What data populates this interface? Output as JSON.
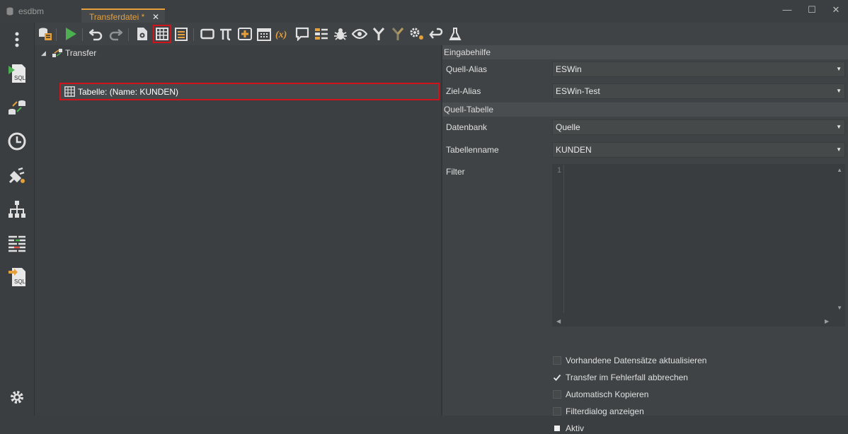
{
  "titlebar": {
    "app_name": "esdbm",
    "tab_label": "Transferdatei *",
    "tab_close": "✕",
    "minimize": "—",
    "maximize": "☐",
    "close": "✕"
  },
  "toolbar": {
    "icons": [
      "database-list-icon",
      "run-icon",
      "undo-icon",
      "redo-icon",
      "file-settings-icon",
      "table-icon",
      "notes-icon",
      "rectangle-icon",
      "pi-icon",
      "add-box-icon",
      "calendar-icon",
      "variable-icon",
      "comment-icon",
      "list-settings-icon",
      "bug-icon",
      "eye-icon",
      "merge-icon",
      "branch-icon",
      "gear-cluster-icon",
      "return-icon",
      "flask-icon"
    ]
  },
  "tree": {
    "root_label": "Transfer",
    "child_label": "Tabelle: (Name: KUNDEN)"
  },
  "props": {
    "section1": "Eingabehilfe",
    "quell_alias_label": "Quell-Alias",
    "quell_alias_value": "ESWin",
    "ziel_alias_label": "Ziel-Alias",
    "ziel_alias_value": "ESWin-Test",
    "section2": "Quell-Tabelle",
    "datenbank_label": "Datenbank",
    "datenbank_value": "Quelle",
    "tabellenname_label": "Tabellenname",
    "tabellenname_value": "KUNDEN",
    "filter_label": "Filter",
    "filter_line": "1",
    "checkboxes": [
      {
        "label": "Vorhandene Datensätze aktualisieren",
        "checked": false
      },
      {
        "label": "Transfer im Fehlerfall abbrechen",
        "checked": true
      },
      {
        "label": "Automatisch Kopieren",
        "checked": false
      },
      {
        "label": "Filterdialog anzeigen",
        "checked": false
      },
      {
        "label": "Aktiv",
        "checked": "partial"
      }
    ]
  },
  "colors": {
    "accent": "#e59f3b",
    "highlight": "#d0141c",
    "run": "#4caf50"
  }
}
